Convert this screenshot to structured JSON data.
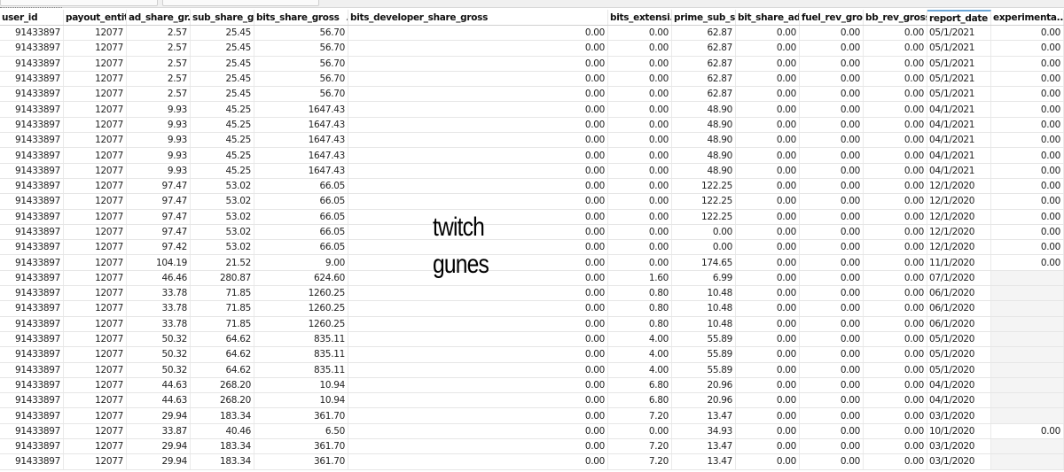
{
  "columns": [
    "user_id",
    "payout_entit...",
    "ad_share_gr...",
    "sub_share_g...",
    "bits_share_gross",
    "bits_developer_share_gross",
    "bits_extensi...",
    "prime_sub_s...",
    "bit_share_ad...",
    "fuel_rev_gross",
    "bb_rev_gross",
    "report_date",
    "experimenta..."
  ],
  "sorted_column_indicator": "▲",
  "overlay": {
    "line1": "twitch",
    "line2": "gunes"
  },
  "rows": [
    [
      "91433897",
      "12077",
      "2.57",
      "25.45",
      "56.70",
      "0.00",
      "0.00",
      "62.87",
      "0.00",
      "0.00",
      "0.00",
      "05/1/2021",
      "0.00"
    ],
    [
      "91433897",
      "12077",
      "2.57",
      "25.45",
      "56.70",
      "0.00",
      "0.00",
      "62.87",
      "0.00",
      "0.00",
      "0.00",
      "05/1/2021",
      "0.00"
    ],
    [
      "91433897",
      "12077",
      "2.57",
      "25.45",
      "56.70",
      "0.00",
      "0.00",
      "62.87",
      "0.00",
      "0.00",
      "0.00",
      "05/1/2021",
      "0.00"
    ],
    [
      "91433897",
      "12077",
      "2.57",
      "25.45",
      "56.70",
      "0.00",
      "0.00",
      "62.87",
      "0.00",
      "0.00",
      "0.00",
      "05/1/2021",
      "0.00"
    ],
    [
      "91433897",
      "12077",
      "2.57",
      "25.45",
      "56.70",
      "0.00",
      "0.00",
      "62.87",
      "0.00",
      "0.00",
      "0.00",
      "05/1/2021",
      "0.00"
    ],
    [
      "91433897",
      "12077",
      "9.93",
      "45.25",
      "1647.43",
      "0.00",
      "0.00",
      "48.90",
      "0.00",
      "0.00",
      "0.00",
      "04/1/2021",
      "0.00"
    ],
    [
      "91433897",
      "12077",
      "9.93",
      "45.25",
      "1647.43",
      "0.00",
      "0.00",
      "48.90",
      "0.00",
      "0.00",
      "0.00",
      "04/1/2021",
      "0.00"
    ],
    [
      "91433897",
      "12077",
      "9.93",
      "45.25",
      "1647.43",
      "0.00",
      "0.00",
      "48.90",
      "0.00",
      "0.00",
      "0.00",
      "04/1/2021",
      "0.00"
    ],
    [
      "91433897",
      "12077",
      "9.93",
      "45.25",
      "1647.43",
      "0.00",
      "0.00",
      "48.90",
      "0.00",
      "0.00",
      "0.00",
      "04/1/2021",
      "0.00"
    ],
    [
      "91433897",
      "12077",
      "9.93",
      "45.25",
      "1647.43",
      "0.00",
      "0.00",
      "48.90",
      "0.00",
      "0.00",
      "0.00",
      "04/1/2021",
      "0.00"
    ],
    [
      "91433897",
      "12077",
      "97.47",
      "53.02",
      "66.05",
      "0.00",
      "0.00",
      "122.25",
      "0.00",
      "0.00",
      "0.00",
      "12/1/2020",
      "0.00"
    ],
    [
      "91433897",
      "12077",
      "97.47",
      "53.02",
      "66.05",
      "0.00",
      "0.00",
      "122.25",
      "0.00",
      "0.00",
      "0.00",
      "12/1/2020",
      "0.00"
    ],
    [
      "91433897",
      "12077",
      "97.47",
      "53.02",
      "66.05",
      "0.00",
      "0.00",
      "122.25",
      "0.00",
      "0.00",
      "0.00",
      "12/1/2020",
      "0.00"
    ],
    [
      "91433897",
      "12077",
      "97.47",
      "53.02",
      "66.05",
      "0.00",
      "0.00",
      "0.00",
      "0.00",
      "0.00",
      "0.00",
      "12/1/2020",
      "0.00"
    ],
    [
      "91433897",
      "12077",
      "97.42",
      "53.02",
      "66.05",
      "0.00",
      "0.00",
      "0.00",
      "0.00",
      "0.00",
      "0.00",
      "12/1/2020",
      "0.00"
    ],
    [
      "91433897",
      "12077",
      "104.19",
      "21.52",
      "9.00",
      "0.00",
      "0.00",
      "174.65",
      "0.00",
      "0.00",
      "0.00",
      "11/1/2020",
      "0.00"
    ],
    [
      "91433897",
      "12077",
      "46.46",
      "280.87",
      "624.60",
      "0.00",
      "1.60",
      "6.99",
      "0.00",
      "0.00",
      "0.00",
      "07/1/2020",
      ""
    ],
    [
      "91433897",
      "12077",
      "33.78",
      "71.85",
      "1260.25",
      "0.00",
      "0.80",
      "10.48",
      "0.00",
      "0.00",
      "0.00",
      "06/1/2020",
      ""
    ],
    [
      "91433897",
      "12077",
      "33.78",
      "71.85",
      "1260.25",
      "0.00",
      "0.80",
      "10.48",
      "0.00",
      "0.00",
      "0.00",
      "06/1/2020",
      ""
    ],
    [
      "91433897",
      "12077",
      "33.78",
      "71.85",
      "1260.25",
      "0.00",
      "0.80",
      "10.48",
      "0.00",
      "0.00",
      "0.00",
      "06/1/2020",
      ""
    ],
    [
      "91433897",
      "12077",
      "50.32",
      "64.62",
      "835.11",
      "0.00",
      "4.00",
      "55.89",
      "0.00",
      "0.00",
      "0.00",
      "05/1/2020",
      ""
    ],
    [
      "91433897",
      "12077",
      "50.32",
      "64.62",
      "835.11",
      "0.00",
      "4.00",
      "55.89",
      "0.00",
      "0.00",
      "0.00",
      "05/1/2020",
      ""
    ],
    [
      "91433897",
      "12077",
      "50.32",
      "64.62",
      "835.11",
      "0.00",
      "4.00",
      "55.89",
      "0.00",
      "0.00",
      "0.00",
      "05/1/2020",
      ""
    ],
    [
      "91433897",
      "12077",
      "44.63",
      "268.20",
      "10.94",
      "0.00",
      "6.80",
      "20.96",
      "0.00",
      "0.00",
      "0.00",
      "04/1/2020",
      ""
    ],
    [
      "91433897",
      "12077",
      "44.63",
      "268.20",
      "10.94",
      "0.00",
      "6.80",
      "20.96",
      "0.00",
      "0.00",
      "0.00",
      "04/1/2020",
      ""
    ],
    [
      "91433897",
      "12077",
      "29.94",
      "183.34",
      "361.70",
      "0.00",
      "7.20",
      "13.47",
      "0.00",
      "0.00",
      "0.00",
      "03/1/2020",
      ""
    ],
    [
      "91433897",
      "12077",
      "33.87",
      "40.46",
      "6.50",
      "0.00",
      "0.00",
      "34.93",
      "0.00",
      "0.00",
      "0.00",
      "10/1/2020",
      "0.00"
    ],
    [
      "91433897",
      "12077",
      "29.94",
      "183.34",
      "361.70",
      "0.00",
      "7.20",
      "13.47",
      "0.00",
      "0.00",
      "0.00",
      "03/1/2020",
      ""
    ],
    [
      "91433897",
      "12077",
      "29.94",
      "183.34",
      "361.70",
      "0.00",
      "7.20",
      "13.47",
      "0.00",
      "0.00",
      "0.00",
      "03/1/2020",
      ""
    ]
  ]
}
